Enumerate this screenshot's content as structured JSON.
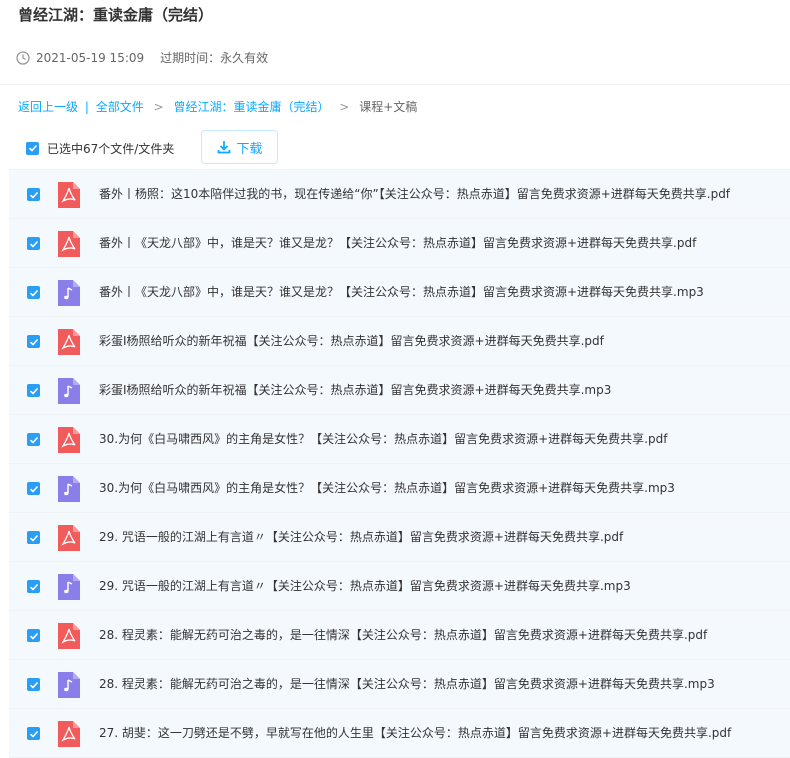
{
  "header": {
    "title": "曾经江湖：重读金庸（完结）",
    "date": "2021-05-19 15:09",
    "expire": "过期时间：永久有效"
  },
  "breadcrumb": {
    "back": "返回上一级",
    "sep": "|",
    "all": "全部文件",
    "folder": "曾经江湖：重读金庸（完结）",
    "current": "课程+文稿"
  },
  "toolbar": {
    "selected": "已选中67个文件/文件夹",
    "download": "下载"
  },
  "colors": {
    "accent": "#09aaff",
    "pdf": "#f15b5b",
    "mp3": "#8a7ee8",
    "checkbox": "#2a9df4"
  },
  "files": [
    {
      "name": "番外丨杨照：这10本陪伴过我的书，现在传递给“你”【关注公众号：热点赤道】留言免费求资源+进群每天免费共享.pdf",
      "type": "pdf"
    },
    {
      "name": "番外丨《天龙八部》中，谁是天？谁又是龙？【关注公众号：热点赤道】留言免费求资源+进群每天免费共享.pdf",
      "type": "pdf"
    },
    {
      "name": "番外丨《天龙八部》中，谁是天？谁又是龙？【关注公众号：热点赤道】留言免费求资源+进群每天免费共享.mp3",
      "type": "mp3"
    },
    {
      "name": "彩蛋I杨照给听众的新年祝福【关注公众号：热点赤道】留言免费求资源+进群每天免费共享.pdf",
      "type": "pdf"
    },
    {
      "name": "彩蛋I杨照给听众的新年祝福【关注公众号：热点赤道】留言免费求资源+进群每天免费共享.mp3",
      "type": "mp3"
    },
    {
      "name": "30.为何《白马啸西风》的主角是女性？【关注公众号：热点赤道】留言免费求资源+进群每天免费共享.pdf",
      "type": "pdf"
    },
    {
      "name": "30.为何《白马啸西风》的主角是女性？【关注公众号：热点赤道】留言免费求资源+进群每天免费共享.mp3",
      "type": "mp3"
    },
    {
      "name": "29. 咒语一般的江湖上有言道〃【关注公众号：热点赤道】留言免费求资源+进群每天免费共享.pdf",
      "type": "pdf"
    },
    {
      "name": "29. 咒语一般的江湖上有言道〃【关注公众号：热点赤道】留言免费求资源+进群每天免费共享.mp3",
      "type": "mp3"
    },
    {
      "name": "28. 程灵素：能解无药可治之毒的，是一往情深【关注公众号：热点赤道】留言免费求资源+进群每天免费共享.pdf",
      "type": "pdf"
    },
    {
      "name": "28. 程灵素：能解无药可治之毒的，是一往情深【关注公众号：热点赤道】留言免费求资源+进群每天免费共享.mp3",
      "type": "mp3"
    },
    {
      "name": "27. 胡斐：这一刀劈还是不劈，早就写在他的人生里【关注公众号：热点赤道】留言免费求资源+进群每天免费共享.pdf",
      "type": "pdf"
    }
  ]
}
